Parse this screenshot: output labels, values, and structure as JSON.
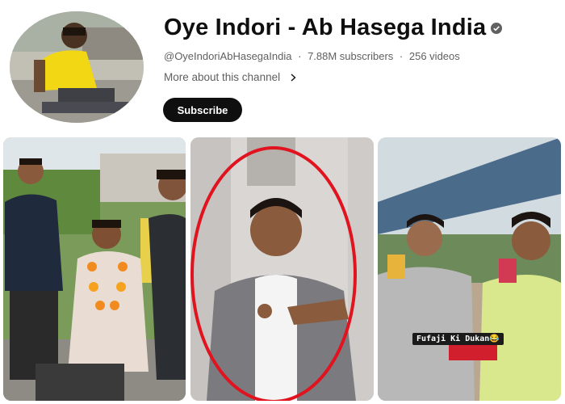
{
  "channel": {
    "name": "Oye Indori - Ab Hasega India",
    "handle": "@OyeIndoriAbHasegaIndia",
    "subscribers": "7.88M subscribers",
    "videos": "256 videos",
    "separator": "·",
    "more_label": "More about this channel",
    "subscribe_label": "Subscribe",
    "verified_icon": "verified-check-icon"
  },
  "shorts": [
    {
      "name": "short-1"
    },
    {
      "name": "short-2",
      "highlight_color": "#e0131f"
    },
    {
      "name": "short-3",
      "caption": "Fufaji Ki Dukan😂"
    }
  ],
  "colors": {
    "text_primary": "#0f0f0f",
    "text_secondary": "#606060",
    "subscribe_bg": "#0f0f0f",
    "highlight_circle": "#e0131f"
  }
}
